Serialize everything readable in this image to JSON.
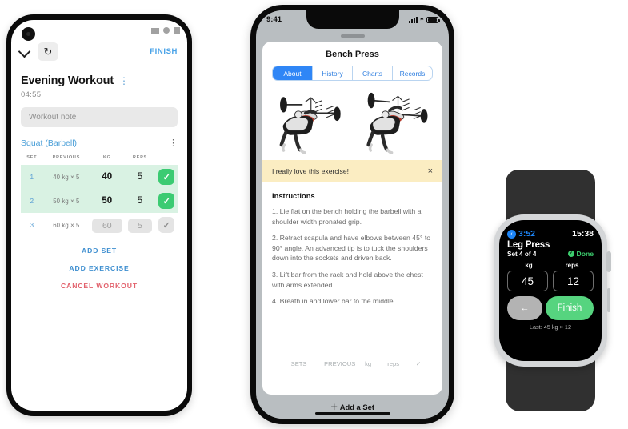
{
  "android": {
    "status_icons": [
      "signal-triangle-icon",
      "circle-icon",
      "square-icon"
    ],
    "appbar": {
      "collapse_icon": "chevron-down-icon",
      "timer_icon": "↻",
      "finish_label": "FINISH"
    },
    "workout": {
      "title": "Evening Workout",
      "overflow_icon": "⋮",
      "elapsed": "04:55",
      "note_placeholder": "Workout note"
    },
    "exercise": {
      "name": "Squat (Barbell)",
      "overflow_icon": "⋮"
    },
    "table": {
      "headers": [
        "SET",
        "PREVIOUS",
        "KG",
        "REPS",
        ""
      ],
      "rows": [
        {
          "set": "1",
          "previous": "40 kg × 5",
          "kg": "40",
          "reps": "5",
          "done": true
        },
        {
          "set": "2",
          "previous": "50 kg × 5",
          "kg": "50",
          "reps": "5",
          "done": true
        },
        {
          "set": "3",
          "previous": "60 kg × 5",
          "kg": "60",
          "reps": "5",
          "done": false
        }
      ]
    },
    "actions": {
      "add_set": "ADD SET",
      "add_exercise": "ADD EXERCISE",
      "cancel_workout": "CANCEL WORKOUT"
    },
    "colors": {
      "accent_blue": "#4a9fd8",
      "done_green": "#3bcb72",
      "done_row_bg": "#d9f2e3",
      "danger_red": "#e2616c"
    }
  },
  "iphone": {
    "status": {
      "time": "9:41",
      "signal_icon": "cellular-bars-icon",
      "wifi_icon": "wifi-icon",
      "battery_icon": "battery-full-icon"
    },
    "sheet": {
      "grabber_icon": "sheet-grabber-icon",
      "title": "Bench Press",
      "tabs": [
        {
          "label": "About",
          "active": true
        },
        {
          "label": "History",
          "active": false
        },
        {
          "label": "Charts",
          "active": false
        },
        {
          "label": "Records",
          "active": false
        }
      ],
      "illustration_alt": "barbell-bench-press-illustration",
      "note": {
        "text": "I really love this exercise!",
        "close_icon": "×"
      },
      "instructions": {
        "heading": "Instructions",
        "steps": [
          "1. Lie flat on the bench holding the barbell with a shoulder width pronated grip.",
          "2. Retract scapula and have elbows between 45° to 90° angle. An advanced tip is to tuck the shoulders down into the sockets and driven back.",
          "3. Lift bar from the rack and hold above the chest with arms extended.",
          "4. Breath in and lower bar to the middle"
        ]
      }
    },
    "behind_sheet_row": [
      "SETS",
      "PREVIOUS",
      "kg",
      "reps",
      "✓"
    ],
    "bottom": {
      "add_set_icon": "plus-icon",
      "add_set_label": "Add a Set",
      "home_indicator": "home-indicator"
    },
    "colors": {
      "tab_active_bg": "#2f86f6",
      "note_bg": "#fbedc2"
    }
  },
  "watch": {
    "back_icon": "‹",
    "rest_timer": "3:52",
    "clock": "15:38",
    "exercise": "Leg Press",
    "set_progress": "Set 4 of 4",
    "done_icon": "✓",
    "done_label": "Done",
    "fields": [
      {
        "unit": "kg",
        "value": "45"
      },
      {
        "unit": "reps",
        "value": "12"
      }
    ],
    "previous_icon": "←",
    "finish_label": "Finish",
    "last": "Last: 45 kg × 12",
    "colors": {
      "accent_blue": "#1d84f5",
      "green": "#56d47f",
      "done_green": "#3ccd6e"
    }
  }
}
